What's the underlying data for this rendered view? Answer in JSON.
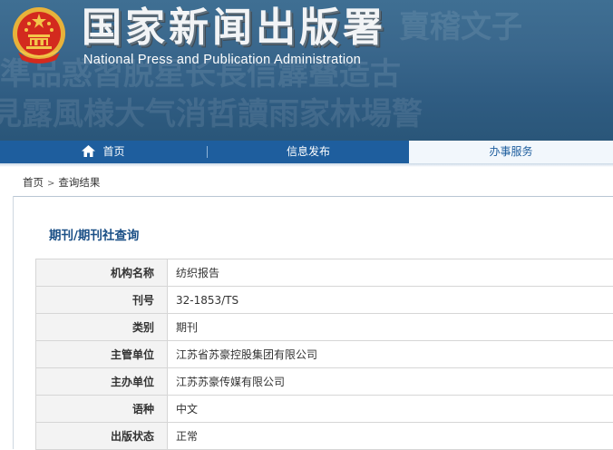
{
  "header": {
    "title_cn": "国家新闻出版署",
    "title_en": "National Press and Publication Administration"
  },
  "nav": {
    "home": "首页",
    "info": "信息发布",
    "services": "办事服务"
  },
  "breadcrumb": {
    "home": "首页",
    "separator": ">",
    "current": "查询结果"
  },
  "section_title": "期刊/期刊社查询",
  "record": [
    {
      "label": "机构名称",
      "value": "纺织报告"
    },
    {
      "label": "刊号",
      "value": "32-1853/TS"
    },
    {
      "label": "类别",
      "value": "期刊"
    },
    {
      "label": "主管单位",
      "value": "江苏省苏豪控股集团有限公司"
    },
    {
      "label": "主办单位",
      "value": "江苏苏豪传媒有限公司"
    },
    {
      "label": "语种",
      "value": "中文"
    },
    {
      "label": "出版状态",
      "value": "正常"
    }
  ],
  "colors": {
    "banner": "#3a678c",
    "nav": "#1e5e9e",
    "nav_active_bg": "#f2f7fc",
    "section_title": "#1a4f86"
  },
  "icons": {
    "emblem": "national-emblem",
    "home": "home-icon"
  }
}
